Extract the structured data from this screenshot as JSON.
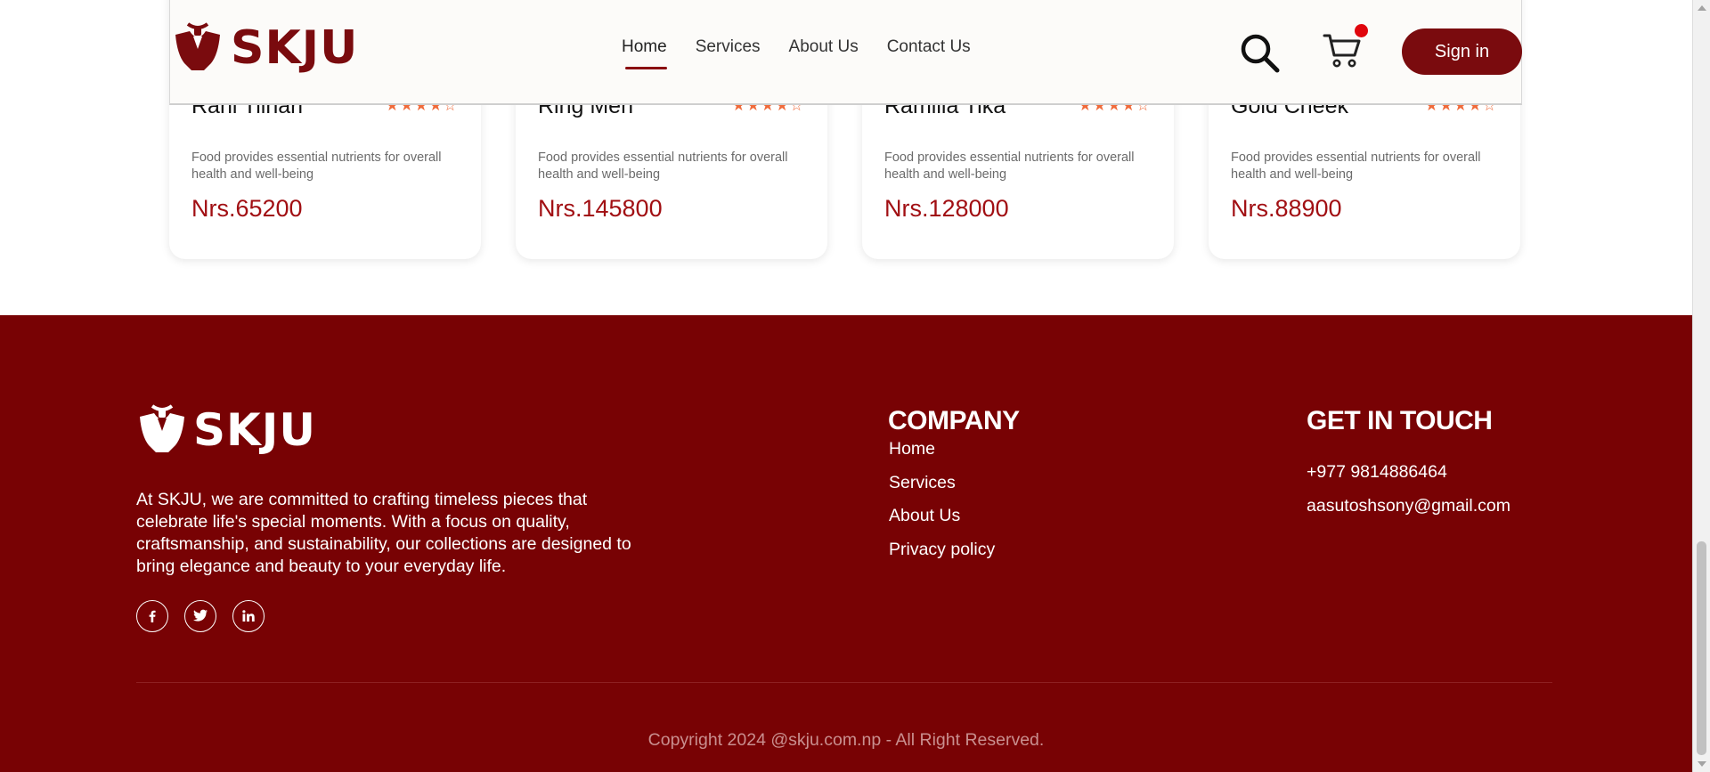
{
  "brand": {
    "name": "SKJU",
    "color": "#7a0b0e"
  },
  "header": {
    "nav": [
      {
        "label": "Home",
        "active": true
      },
      {
        "label": "Services",
        "active": false
      },
      {
        "label": "About Us",
        "active": false
      },
      {
        "label": "Contact Us",
        "active": false
      }
    ],
    "search_icon": "search-icon",
    "cart_icon": "cart-icon",
    "signin_label": "Sign in"
  },
  "products": [
    {
      "name": "Rani Tilhari",
      "rating": 4,
      "max_rating": 5,
      "description": "Food provides essential nutrients for overall health and well-being",
      "price": "Nrs.65200"
    },
    {
      "name": "Ring Men",
      "rating": 4,
      "max_rating": 5,
      "description": "Food provides essential nutrients for overall health and well-being",
      "price": "Nrs.145800"
    },
    {
      "name": "Ramlila Tika",
      "rating": 4,
      "max_rating": 5,
      "description": "Food provides essential nutrients for overall health and well-being",
      "price": "Nrs.128000"
    },
    {
      "name": "Gold Cheek",
      "rating": 4,
      "max_rating": 5,
      "description": "Food provides essential nutrients for overall health and well-being",
      "price": "Nrs.88900"
    }
  ],
  "footer": {
    "about": "At SKJU, we are committed to crafting timeless pieces that celebrate life's special moments. With a focus on quality, craftsmanship, and sustainability, our collections are designed to bring elegance and beauty to your everyday life.",
    "socials": [
      "facebook-icon",
      "twitter-icon",
      "linkedin-icon"
    ],
    "company_title": "COMPANY",
    "company_links": [
      "Home",
      "Services",
      "About Us",
      "Privacy policy"
    ],
    "contact_title": "GET IN TOUCH",
    "phone": "+977 9814886464",
    "email": "aasutoshsony@gmail.com",
    "copyright": "Copyright 2024 @skju.com.np - All Right Reserved.",
    "background": "#780204"
  }
}
